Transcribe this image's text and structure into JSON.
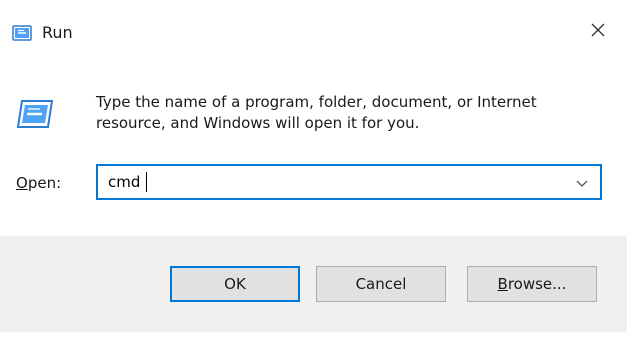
{
  "window": {
    "title": "Run",
    "close_symbol": "✕"
  },
  "dialog": {
    "description": "Type the name of a program, folder, document, or Internet resource, and Windows will open it for you.",
    "open_label_mnemonic": "O",
    "open_label_rest": "pen:",
    "input_value": "cmd"
  },
  "buttons": {
    "ok_label": "OK",
    "cancel_label": "Cancel",
    "browse_mnemonic": "B",
    "browse_rest": "rowse..."
  },
  "colors": {
    "accent": "#0078d7",
    "footer_bg": "#f0f0f0",
    "button_bg": "#e1e1e1"
  },
  "icons": {
    "title": "run-icon",
    "dialog": "run-icon-large",
    "close": "close-icon",
    "dropdown": "chevron-down-icon"
  }
}
